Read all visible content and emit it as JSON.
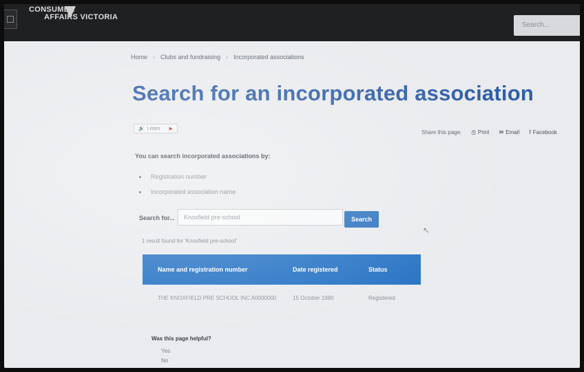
{
  "header": {
    "logo_line1": "CONSUMER",
    "logo_line2": "AFFAIRS VICTORIA",
    "search_placeholder": "Search..."
  },
  "breadcrumb": [
    "Home",
    "Clubs and fundraising",
    "Incorporated associations"
  ],
  "page_title": "Search for an incorporated association",
  "listen_label": "Listen",
  "share": {
    "label": "Share this page:",
    "items": [
      "Print",
      "Email",
      "Facebook"
    ]
  },
  "intro": "You can search incorporated associations by:",
  "search_options": [
    "Registration number",
    "Incorporated association name"
  ],
  "search_form": {
    "label": "Search for...",
    "value": "Knoxfield pre-school",
    "button": "Search"
  },
  "result_count_text": "1 result found for 'Knoxfield pre-school'",
  "results_table": {
    "columns": [
      "Name and registration number",
      "Date registered",
      "Status"
    ],
    "rows": [
      [
        "THE KNOXFIELD PRE SCHOOL INC A0000000",
        "15 October 1980",
        "Registered"
      ]
    ]
  },
  "feedback": {
    "question": "Was this page helpful?",
    "options": [
      "Yes",
      "No"
    ]
  },
  "colors": {
    "header_bg": "#1f2022",
    "title_blue": "#2f5fa8",
    "table_header_blue": "#2a75c5",
    "button_blue": "#2f74c0"
  }
}
